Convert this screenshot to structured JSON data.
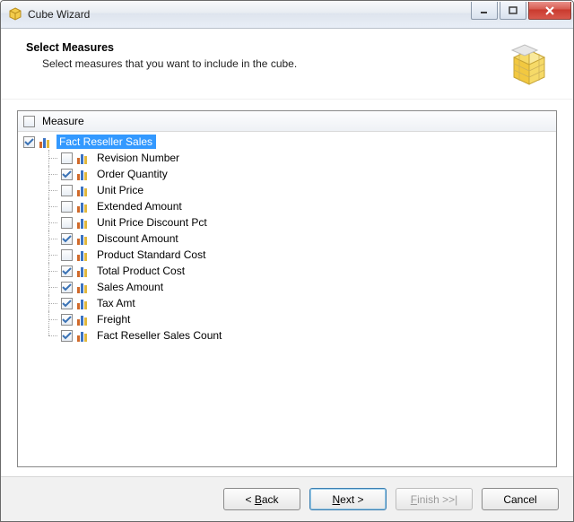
{
  "window": {
    "title": "Cube Wizard"
  },
  "header": {
    "title": "Select Measures",
    "subtitle": "Select measures that you want to include in the cube."
  },
  "tree": {
    "header_label": "Measure",
    "header_checked": false,
    "group": {
      "label": "Fact Reseller Sales",
      "checked": true,
      "selected": true
    },
    "items": [
      {
        "label": "Revision Number",
        "checked": false
      },
      {
        "label": "Order Quantity",
        "checked": true
      },
      {
        "label": "Unit Price",
        "checked": false
      },
      {
        "label": "Extended Amount",
        "checked": false
      },
      {
        "label": "Unit Price Discount Pct",
        "checked": false
      },
      {
        "label": "Discount Amount",
        "checked": true
      },
      {
        "label": "Product Standard Cost",
        "checked": false
      },
      {
        "label": "Total Product Cost",
        "checked": true
      },
      {
        "label": "Sales Amount",
        "checked": true
      },
      {
        "label": "Tax Amt",
        "checked": true
      },
      {
        "label": "Freight",
        "checked": true
      },
      {
        "label": "Fact Reseller Sales Count",
        "checked": true
      }
    ]
  },
  "buttons": {
    "back": "< Back",
    "next": "Next >",
    "finish": "Finish >>|",
    "cancel": "Cancel"
  }
}
